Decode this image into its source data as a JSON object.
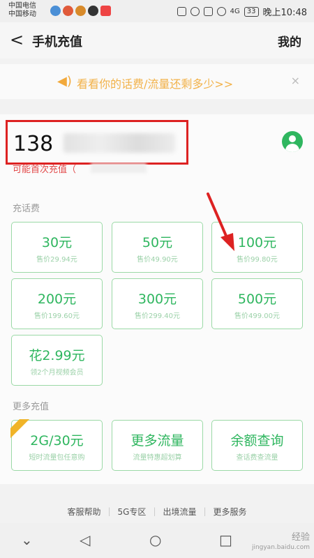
{
  "status_bar": {
    "carrier1": "中国电信",
    "carrier2": "中国移动",
    "network": "4G",
    "battery": "33",
    "time": "晚上10:48"
  },
  "nav": {
    "back": "<",
    "title": "手机充值",
    "right": "我的"
  },
  "banner": {
    "text": "看看你的话费/流量还剩多少>>",
    "close": "×"
  },
  "account": {
    "phone_prefix": "138",
    "first_hint": "可能首次充值（"
  },
  "recharge": {
    "section": "充话费",
    "options": [
      {
        "amount": "30元",
        "price": "售价29.94元"
      },
      {
        "amount": "50元",
        "price": "售价49.90元"
      },
      {
        "amount": "100元",
        "price": "售价99.80元"
      },
      {
        "amount": "200元",
        "price": "售价199.60元"
      },
      {
        "amount": "300元",
        "price": "售价299.40元"
      },
      {
        "amount": "500元",
        "price": "售价499.00元"
      },
      {
        "amount": "花2.99元",
        "price": "领2个月视频会员"
      }
    ]
  },
  "more": {
    "section": "更多充值",
    "options": [
      {
        "title": "2G/30元",
        "desc": "短时流量包任意购",
        "tag": "hot"
      },
      {
        "title": "更多流量",
        "desc": "流量特惠超划算"
      },
      {
        "title": "余额查询",
        "desc": "查话费查流量"
      }
    ]
  },
  "footer_links": [
    "客服帮助",
    "5G专区",
    "出境流量",
    "更多服务"
  ],
  "watermark": {
    "title": "经验",
    "url": "jingyan.baidu.com"
  },
  "colors": {
    "accent": "#2fb65f",
    "banner": "#f2b24a",
    "highlight_box": "#dd2222"
  }
}
